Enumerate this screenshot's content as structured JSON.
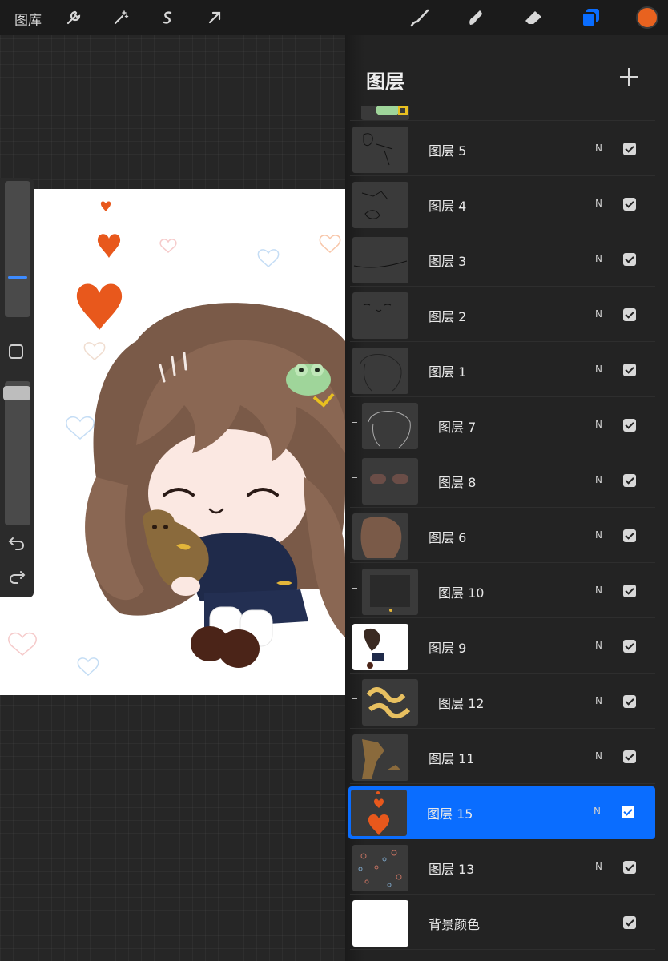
{
  "toolbar": {
    "gallery_label": "图库",
    "left_tools": [
      "wrench-icon",
      "magic-wand-icon",
      "selection-icon",
      "transform-arrow-icon"
    ],
    "right_tools": [
      "brush-icon",
      "smudge-icon",
      "eraser-icon",
      "layers-icon"
    ],
    "current_color": "#e8621f",
    "accent": "#0a6dff"
  },
  "layers_panel": {
    "title": "图层",
    "layers": [
      {
        "name": "图层 5",
        "blend": "N",
        "visible": true,
        "clipped": false,
        "selected": false
      },
      {
        "name": "图层 4",
        "blend": "N",
        "visible": true,
        "clipped": false,
        "selected": false
      },
      {
        "name": "图层 3",
        "blend": "N",
        "visible": true,
        "clipped": false,
        "selected": false
      },
      {
        "name": "图层 2",
        "blend": "N",
        "visible": true,
        "clipped": false,
        "selected": false
      },
      {
        "name": "图层 1",
        "blend": "N",
        "visible": true,
        "clipped": false,
        "selected": false
      },
      {
        "name": "图层 7",
        "blend": "N",
        "visible": true,
        "clipped": true,
        "selected": false
      },
      {
        "name": "图层 8",
        "blend": "N",
        "visible": true,
        "clipped": true,
        "selected": false
      },
      {
        "name": "图层 6",
        "blend": "N",
        "visible": true,
        "clipped": false,
        "selected": false
      },
      {
        "name": "图层 10",
        "blend": "N",
        "visible": true,
        "clipped": true,
        "selected": false
      },
      {
        "name": "图层 9",
        "blend": "N",
        "visible": true,
        "clipped": false,
        "selected": false
      },
      {
        "name": "图层 12",
        "blend": "N",
        "visible": true,
        "clipped": true,
        "selected": false
      },
      {
        "name": "图层 11",
        "blend": "N",
        "visible": true,
        "clipped": false,
        "selected": false
      },
      {
        "name": "图层 15",
        "blend": "N",
        "visible": true,
        "clipped": false,
        "selected": true
      },
      {
        "name": "图层 13",
        "blend": "N",
        "visible": true,
        "clipped": false,
        "selected": false
      }
    ],
    "background_layer": {
      "name": "背景颜色",
      "visible": true
    }
  }
}
